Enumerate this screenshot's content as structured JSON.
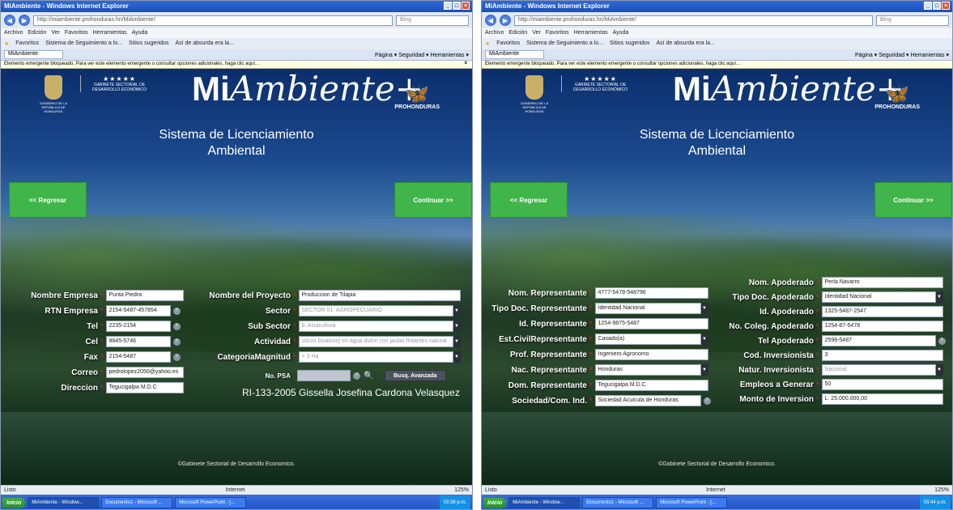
{
  "browser": {
    "window_title": "MiAmbiente - Windows Internet Explorer",
    "address": "http://miambiente.prohonduras.hn/MiAmbiente/",
    "search_placeholder": "Bing",
    "menu": [
      "Archivo",
      "Edición",
      "Ver",
      "Favoritos",
      "Herramientas",
      "Ayuda"
    ],
    "favorites": [
      "Favoritos",
      "Sistema de Seguimiento a lo...",
      "Sitios sugeridos",
      "Así de absurda era la..."
    ],
    "tab_label": "MiAmbiente",
    "tools": "Página ▾  Seguridad ▾  Herramientas ▾",
    "popup_message": "Elemento emergente bloqueado. Para ver este elemento emergente o consultar opciones adicionales, haga clic aquí...",
    "status_left": "Listo",
    "status_zone": "Internet",
    "zoom": "125%"
  },
  "header": {
    "crest_caption": "GOBIERNO DE LA REPÚBLICA DE HONDURAS",
    "gabinete": "GABINETE SECTORIAL DE DESARROLLO ECONÓMICO",
    "stars": "★★★★★",
    "logo_mi": "Mi",
    "logo_ambiente": "Ambiente+",
    "prohonduras": "PROHONDURAS",
    "subtitle_line1": "Sistema de Licenciamiento",
    "subtitle_line2": "Ambiental"
  },
  "nav": {
    "back": "<< Regresar",
    "next": "Continuar >>"
  },
  "footer": "©Gabinete Sectorial de Desarrollo Economico.",
  "taskbar": {
    "start": "Inicio",
    "tasks": [
      "MiAmbiente - Window...",
      "Documento1 - Microsoft ...",
      "Microsoft PowerPoint - [..."
    ],
    "clock_left": "03:38 p.m.",
    "clock_right": "03:44 p.m."
  },
  "screen1": {
    "empresa": {
      "nombre_label": "Nombre Empresa",
      "nombre": "Punta Piedra",
      "rtn_label": "RTN Empresa",
      "rtn": "2154-5487-457854",
      "tel_label": "Tel",
      "tel": "2235-2154",
      "cel_label": "Cel",
      "cel": "9845-5746",
      "fax_label": "Fax",
      "fax": "2154-5487",
      "correo_label": "Correo",
      "correo": "pedrolopez2050@yahoo.es",
      "direccion_label": "Direccion",
      "direccion": "Tegucigalpa M.D.C"
    },
    "proyecto": {
      "nombre_label": "Nombre del Proyecto",
      "nombre": "Produccion de Tilapia",
      "sector_label": "Sector",
      "sector": "SECTOR 01. AGROPECUARIO",
      "subsector_label": "Sub Sector",
      "subsector": "b. Acuicultura",
      "actividad_label": "Actividad",
      "actividad": "uscos  bivalvos) en agua dulce con jaulas flotantes natural",
      "categoria_label": "CategoriaMagnitud",
      "categoria": "> 3 Ha",
      "psa_label": "No. PSA",
      "busq": "Busq. Avanzada",
      "resolucion": "RI-133-2005 Gissella Josefina Cardona Velasquez"
    }
  },
  "screen2": {
    "representante": {
      "nom_label": "Nom. Representante",
      "nom": "4777-5478-548796",
      "tipo_label": "Tipo Doc. Representante",
      "tipo": "Identidad Nacional",
      "id_label": "Id. Representante",
      "id": "1254-9875-5487",
      "civil_label": "Est.CivilRepresentante",
      "civil": "Casado(a)",
      "prof_label": "Prof. Representante",
      "prof": "Ingeniero Agronomo",
      "nac_label": "Nac. Representante",
      "nac": "Honduras",
      "dom_label": "Dom. Representante",
      "dom": "Tegucigalpa M.D.C",
      "soc_label": "Sociedad/Com. Ind.",
      "soc": "Sociedad Acuicula de Honduras"
    },
    "apoderado": {
      "nom_label": "Nom. Apoderado",
      "nom": "Perla Navarro",
      "tipo_label": "Tipo Doc. Apoderado",
      "tipo": "Identidad Nacional",
      "id_label": "Id. Apoderado",
      "id": "1325-5487-2547",
      "coleg_label": "No. Coleg. Apoderado",
      "coleg": "1254-87-5478",
      "tel_label": "Tel Apoderado",
      "tel": "2598-5487",
      "cod_label": "Cod. Inversionista",
      "cod": "3",
      "natur_label": "Natur. Inversionista",
      "natur": "Nacional",
      "empleos_label": "Empleos a Generar",
      "empleos": "50",
      "monto_label": "Monto de Inversion",
      "monto": "L.  25.000.000,00"
    }
  }
}
